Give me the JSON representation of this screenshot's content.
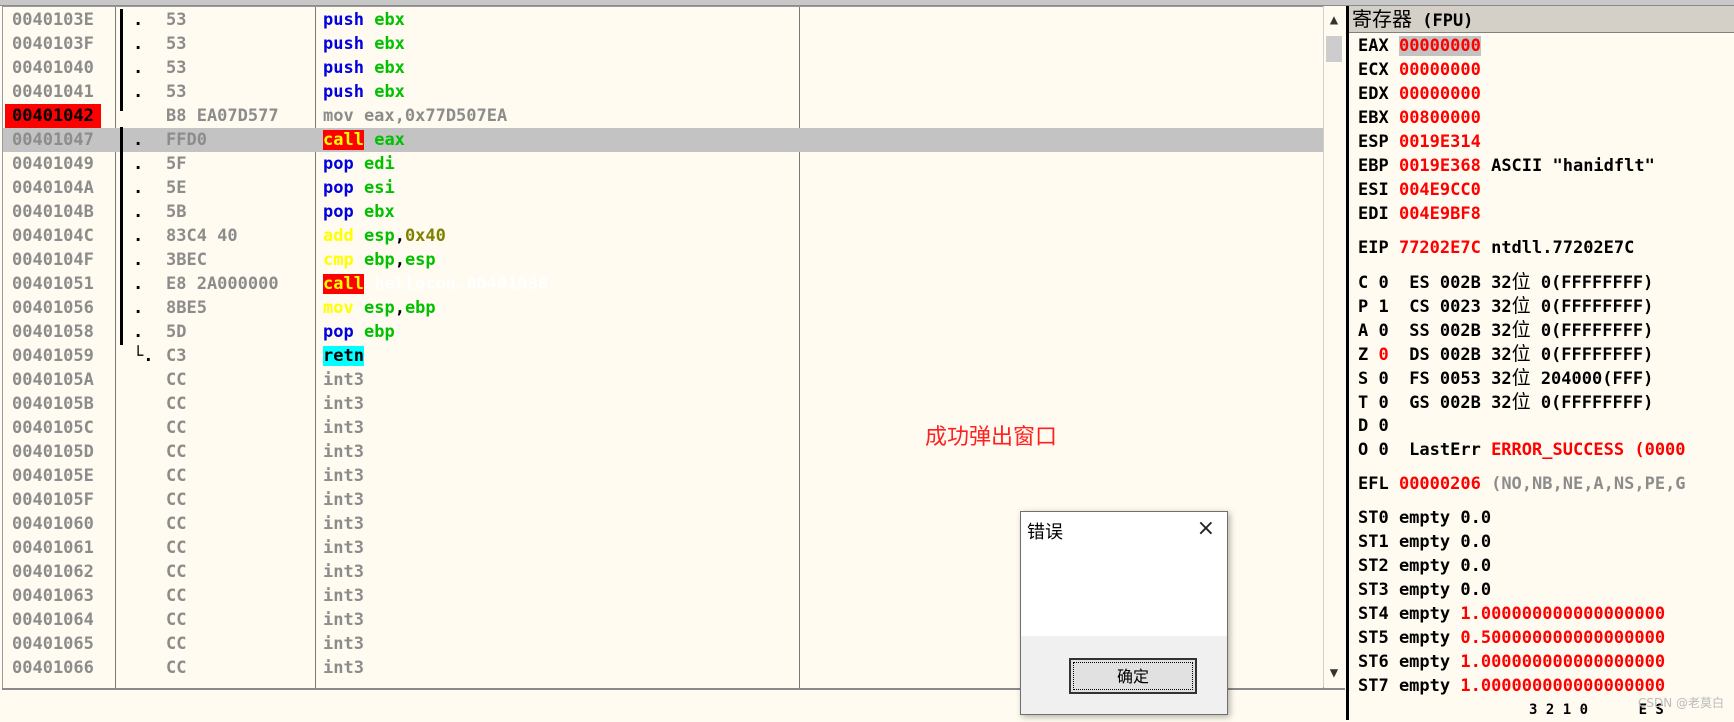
{
  "rows": [
    {
      "addr": "0040103E",
      "mark": ".",
      "hex": "53",
      "asm": [
        [
          "push",
          "mn-push"
        ],
        [
          " ",
          ""
        ],
        [
          "ebx",
          "op-reg"
        ]
      ]
    },
    {
      "addr": "0040103F",
      "mark": ".",
      "hex": "53",
      "asm": [
        [
          "push",
          "mn-push"
        ],
        [
          " ",
          ""
        ],
        [
          "ebx",
          "op-reg"
        ]
      ]
    },
    {
      "addr": "00401040",
      "mark": ".",
      "hex": "53",
      "asm": [
        [
          "push",
          "mn-push"
        ],
        [
          " ",
          ""
        ],
        [
          "ebx",
          "op-reg"
        ]
      ]
    },
    {
      "addr": "00401041",
      "mark": ".",
      "hex": "53",
      "asm": [
        [
          "push",
          "mn-push"
        ],
        [
          " ",
          ""
        ],
        [
          "ebx",
          "op-reg"
        ]
      ]
    },
    {
      "addr": "00401042",
      "mark": "",
      "hex": "B8 EA07D577",
      "bp": true,
      "asm": [
        [
          "mov eax,0x77D507EA",
          "mn-mov"
        ]
      ]
    },
    {
      "addr": "00401047",
      "mark": ".",
      "hex": "FFD0",
      "sel": true,
      "asm": [
        [
          "call",
          "mn-call"
        ],
        [
          " ",
          ""
        ],
        [
          "eax",
          "op-reg"
        ]
      ]
    },
    {
      "addr": "00401049",
      "mark": ".",
      "hex": "5F",
      "asm": [
        [
          "pop",
          "mn-pop"
        ],
        [
          " ",
          ""
        ],
        [
          "edi",
          "op-reg"
        ]
      ]
    },
    {
      "addr": "0040104A",
      "mark": ".",
      "hex": "5E",
      "asm": [
        [
          "pop",
          "mn-pop"
        ],
        [
          " ",
          ""
        ],
        [
          "esi",
          "op-reg"
        ]
      ]
    },
    {
      "addr": "0040104B",
      "mark": ".",
      "hex": "5B",
      "asm": [
        [
          "pop",
          "mn-pop"
        ],
        [
          " ",
          ""
        ],
        [
          "ebx",
          "op-reg"
        ]
      ]
    },
    {
      "addr": "0040104C",
      "mark": ".",
      "hex": "83C4 40",
      "asm": [
        [
          "add",
          "mn-add"
        ],
        [
          " ",
          ""
        ],
        [
          "esp",
          "op-reg"
        ],
        [
          ",",
          ""
        ],
        [
          "0x40",
          "op-num"
        ]
      ]
    },
    {
      "addr": "0040104F",
      "mark": ".",
      "hex": "3BEC",
      "asm": [
        [
          "cmp",
          "mn-cmp"
        ],
        [
          " ",
          ""
        ],
        [
          "ebp",
          "op-reg"
        ],
        [
          ",",
          ""
        ],
        [
          "esp",
          "op-reg"
        ]
      ]
    },
    {
      "addr": "00401051",
      "mark": ".",
      "hex": "E8 2A000000",
      "asm": [
        [
          "call",
          "mn-call"
        ],
        [
          " ",
          ""
        ],
        [
          "hellocon.00401080",
          "op-call"
        ]
      ]
    },
    {
      "addr": "00401056",
      "mark": ".",
      "hex": "8BE5",
      "asm": [
        [
          "mov",
          "mn-mov2"
        ],
        [
          " ",
          ""
        ],
        [
          "esp",
          "op-reg"
        ],
        [
          ",",
          ""
        ],
        [
          "ebp",
          "op-reg"
        ]
      ]
    },
    {
      "addr": "00401058",
      "mark": ".",
      "hex": "5D",
      "asm": [
        [
          "pop",
          "mn-pop"
        ],
        [
          " ",
          ""
        ],
        [
          "ebp",
          "op-reg"
        ]
      ]
    },
    {
      "addr": "00401059",
      "mark": "└.",
      "hex": "C3",
      "asm": [
        [
          "retn",
          "mn-retn"
        ]
      ]
    },
    {
      "addr": "0040105A",
      "mark": "",
      "hex": "CC",
      "asm": [
        [
          "int3",
          "mn-int3"
        ]
      ]
    },
    {
      "addr": "0040105B",
      "mark": "",
      "hex": "CC",
      "asm": [
        [
          "int3",
          "mn-int3"
        ]
      ]
    },
    {
      "addr": "0040105C",
      "mark": "",
      "hex": "CC",
      "asm": [
        [
          "int3",
          "mn-int3"
        ]
      ]
    },
    {
      "addr": "0040105D",
      "mark": "",
      "hex": "CC",
      "asm": [
        [
          "int3",
          "mn-int3"
        ]
      ]
    },
    {
      "addr": "0040105E",
      "mark": "",
      "hex": "CC",
      "asm": [
        [
          "int3",
          "mn-int3"
        ]
      ]
    },
    {
      "addr": "0040105F",
      "mark": "",
      "hex": "CC",
      "asm": [
        [
          "int3",
          "mn-int3"
        ]
      ]
    },
    {
      "addr": "00401060",
      "mark": "",
      "hex": "CC",
      "asm": [
        [
          "int3",
          "mn-int3"
        ]
      ]
    },
    {
      "addr": "00401061",
      "mark": "",
      "hex": "CC",
      "asm": [
        [
          "int3",
          "mn-int3"
        ]
      ]
    },
    {
      "addr": "00401062",
      "mark": "",
      "hex": "CC",
      "asm": [
        [
          "int3",
          "mn-int3"
        ]
      ]
    },
    {
      "addr": "00401063",
      "mark": "",
      "hex": "CC",
      "asm": [
        [
          "int3",
          "mn-int3"
        ]
      ]
    },
    {
      "addr": "00401064",
      "mark": "",
      "hex": "CC",
      "asm": [
        [
          "int3",
          "mn-int3"
        ]
      ]
    },
    {
      "addr": "00401065",
      "mark": "",
      "hex": "CC",
      "asm": [
        [
          "int3",
          "mn-int3"
        ]
      ]
    },
    {
      "addr": "00401066",
      "mark": "",
      "hex": "CC",
      "asm": [
        [
          "int3",
          "mn-int3"
        ]
      ]
    }
  ],
  "note": "成功弹出窗口",
  "registers": {
    "title_cn": "寄存器",
    "title_en": " (FPU)",
    "gp": [
      {
        "name": "EAX",
        "value": "00000000",
        "hl": true,
        "extra": ""
      },
      {
        "name": "ECX",
        "value": "00000000",
        "extra": ""
      },
      {
        "name": "EDX",
        "value": "00000000",
        "extra": ""
      },
      {
        "name": "EBX",
        "value": "00800000",
        "extra": ""
      },
      {
        "name": "ESP",
        "value": "0019E314",
        "extra": ""
      },
      {
        "name": "EBP",
        "value": "0019E368",
        "extra": " ASCII \"hanidflt\""
      },
      {
        "name": "ESI",
        "value": "004E9CC0",
        "extra": ""
      },
      {
        "name": "EDI",
        "value": "004E9BF8",
        "extra": ""
      }
    ],
    "eip": {
      "name": "EIP",
      "value": "77202E7C",
      "extra": " ntdll.77202E7C"
    },
    "flags": [
      {
        "f": "C",
        "v": "0",
        "seg": "ES",
        "sel": "002B",
        "bits": "32",
        "cn": "位",
        "rest": " 0(FFFFFFFF)"
      },
      {
        "f": "P",
        "v": "1",
        "seg": "CS",
        "sel": "0023",
        "bits": "32",
        "cn": "位",
        "rest": " 0(FFFFFFFF)"
      },
      {
        "f": "A",
        "v": "0",
        "seg": "SS",
        "sel": "002B",
        "bits": "32",
        "cn": "位",
        "rest": " 0(FFFFFFFF)"
      },
      {
        "f": "Z",
        "v": "0",
        "red": true,
        "seg": "DS",
        "sel": "002B",
        "bits": "32",
        "cn": "位",
        "rest": " 0(FFFFFFFF)"
      },
      {
        "f": "S",
        "v": "0",
        "seg": "FS",
        "sel": "0053",
        "bits": "32",
        "cn": "位",
        "rest": " 204000(FFF)"
      },
      {
        "f": "T",
        "v": "0",
        "seg": "GS",
        "sel": "002B",
        "bits": "32",
        "cn": "位",
        "rest": " 0(FFFFFFFF)"
      },
      {
        "f": "D",
        "v": "0",
        "seg": "",
        "sel": "",
        "bits": "",
        "cn": "",
        "rest": ""
      }
    ],
    "lasterr": {
      "label": "O 0  LastErr ",
      "value": "ERROR_SUCCESS (0000"
    },
    "efl": {
      "name": "EFL",
      "value": "00000206",
      "extra": " (NO,NB,NE,A,NS,PE,G"
    },
    "st": [
      {
        "name": "ST0",
        "state": "empty",
        "value": "0.0",
        "red": false
      },
      {
        "name": "ST1",
        "state": "empty",
        "value": "0.0",
        "red": false
      },
      {
        "name": "ST2",
        "state": "empty",
        "value": "0.0",
        "red": false
      },
      {
        "name": "ST3",
        "state": "empty",
        "value": "0.0",
        "red": false
      },
      {
        "name": "ST4",
        "state": "empty",
        "value": "1.000000000000000000",
        "red": true
      },
      {
        "name": "ST5",
        "state": "empty",
        "value": "0.500000000000000000",
        "red": true
      },
      {
        "name": "ST6",
        "state": "empty",
        "value": "1.000000000000000000",
        "red": true
      },
      {
        "name": "ST7",
        "state": "empty",
        "value": "1.000000000000000000",
        "red": true
      }
    ],
    "bottom_hint": "3 2 1 0      E S"
  },
  "watermark": "CSDN @老莫白",
  "dialog": {
    "title": "错误",
    "close": "×",
    "ok": "确定"
  },
  "scroll": {
    "up": "▲",
    "down": "▼"
  }
}
